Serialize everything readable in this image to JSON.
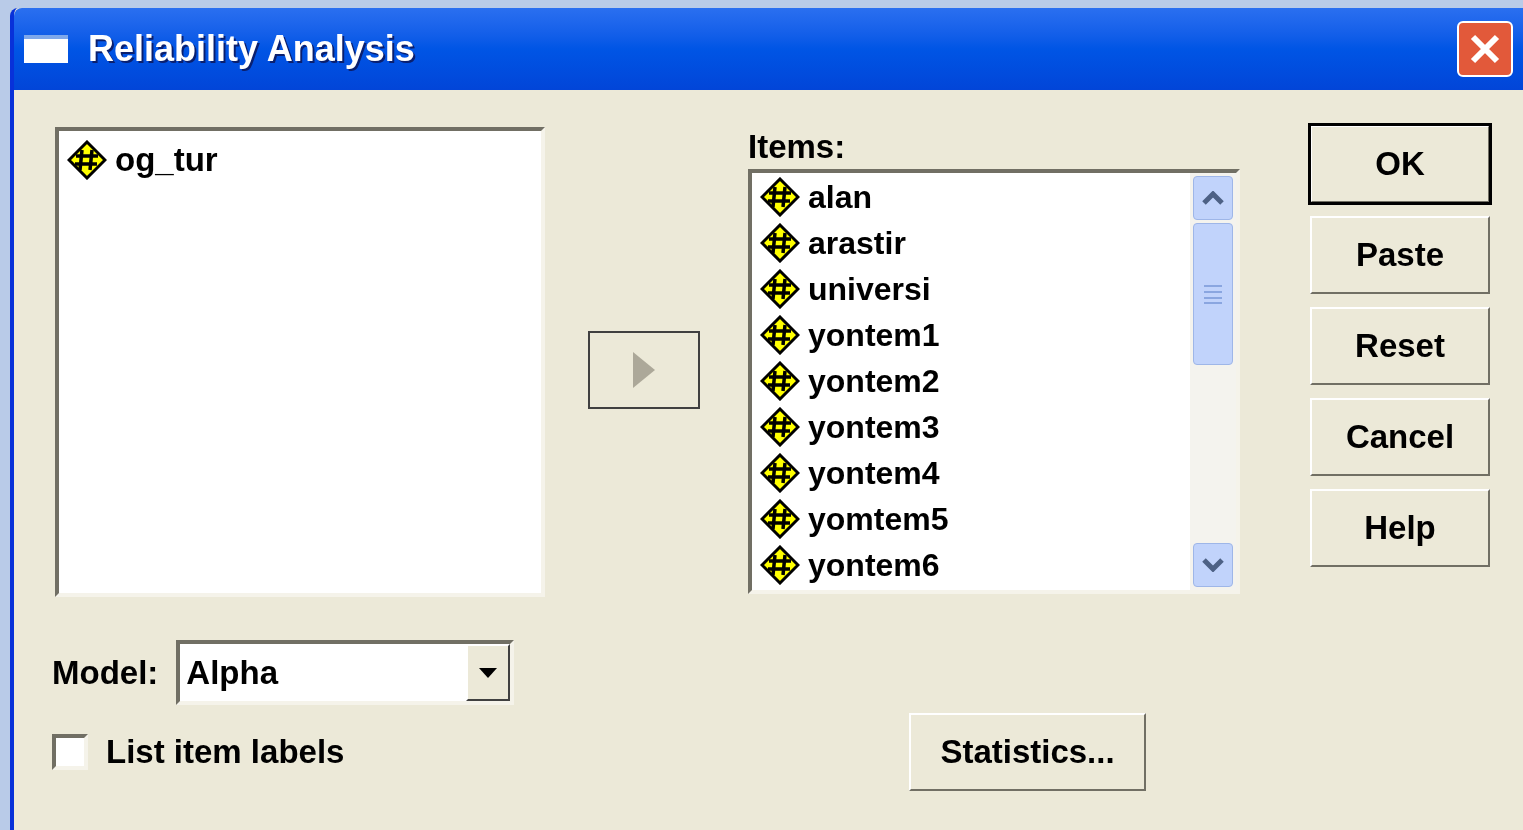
{
  "window": {
    "title": "Reliability Analysis"
  },
  "source_list": [
    {
      "name": "og_tur"
    }
  ],
  "items_label": "Items:",
  "items": [
    {
      "name": "alan"
    },
    {
      "name": "arastir"
    },
    {
      "name": "universi"
    },
    {
      "name": "yontem1"
    },
    {
      "name": "yontem2"
    },
    {
      "name": "yontem3"
    },
    {
      "name": "yontem4"
    },
    {
      "name": "yomtem5"
    },
    {
      "name": "yontem6"
    }
  ],
  "buttons": [
    {
      "label": "OK",
      "default": true
    },
    {
      "label": "Paste",
      "default": false
    },
    {
      "label": "Reset",
      "default": false
    },
    {
      "label": "Cancel",
      "default": false
    },
    {
      "label": "Help",
      "default": false
    }
  ],
  "model": {
    "label": "Model:",
    "value": "Alpha"
  },
  "list_item_labels": {
    "label": "List item labels",
    "checked": false
  },
  "statistics_button": "Statistics..."
}
